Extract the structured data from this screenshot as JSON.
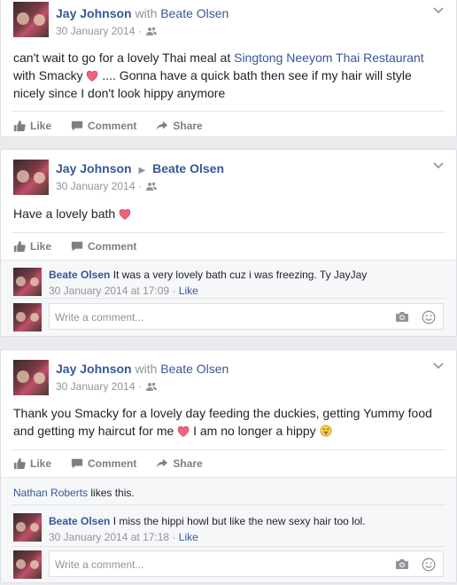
{
  "posts": [
    {
      "author": "Jay Johnson",
      "connector": "with",
      "tagged": "Beate Olsen",
      "date": "30 January 2014 ·",
      "text_1": "can't wait to go for a lovely Thai meal at ",
      "link": "Singtong Neeyom Thai Restaurant",
      "text_2": "with Smacky ",
      "text_3": " .... Gonna have a quick bath then see if my hair will style nicely since I don't look hippy anymore",
      "actions": [
        "Like",
        "Comment",
        "Share"
      ]
    },
    {
      "author": "Jay Johnson",
      "arrow": "▶",
      "target": "Beate Olsen",
      "date": "30 January 2014 ·",
      "text": "Have a lovely bath ",
      "actions": [
        "Like",
        "Comment"
      ],
      "comment": {
        "author": "Beate Olsen",
        "text": "It was a very lovely bath cuz i was freezing. Ty JayJay",
        "date": "30 January 2014 at 17:09 · ",
        "like": "Like"
      },
      "write_placeholder": "Write a comment..."
    },
    {
      "author": "Jay Johnson",
      "connector": "with",
      "tagged": "Beate Olsen",
      "date": "30 January 2014 ·",
      "text_1": "Thank you Smacky for a lovely day feeding the duckies, getting Yummy food and getting my haircut for me ",
      "text_2": " I am no longer a hippy ",
      "actions": [
        "Like",
        "Comment",
        "Share"
      ],
      "likes_name": "Nathan Roberts",
      "likes_text": " likes this.",
      "comment": {
        "author": "Beate Olsen",
        "text": "I miss the hippi howl but like the new sexy hair too lol.",
        "date": "30 January 2014 at 17:18 · ",
        "like": "Like"
      },
      "write_placeholder": "Write a comment..."
    }
  ],
  "colors": {
    "link": "#365899",
    "meta": "#90949c",
    "heart": "#e0245e"
  }
}
